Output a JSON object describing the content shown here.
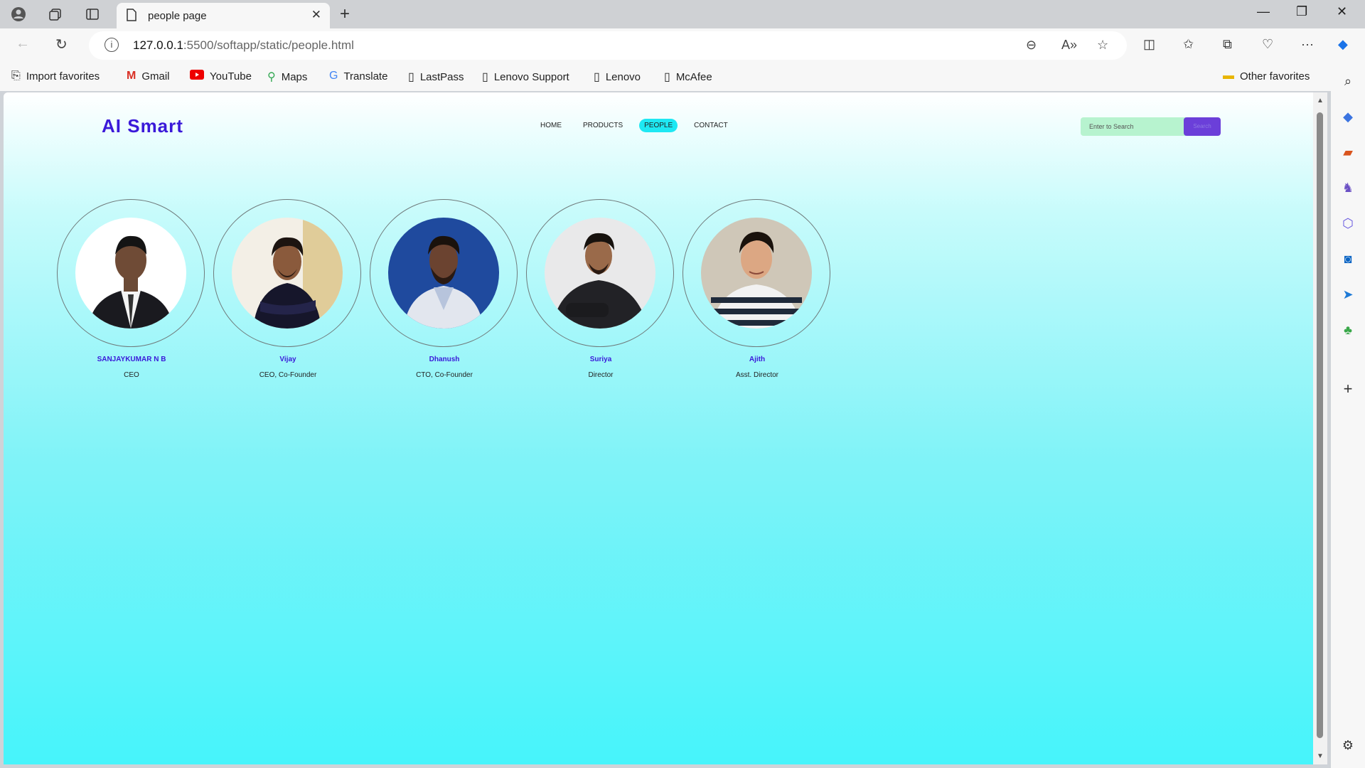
{
  "browser": {
    "tab_title": "people page",
    "url_host": "127.0.0.1",
    "url_rest": ":5500/softapp/static/people.html"
  },
  "bookmarks": [
    {
      "label": "Import favorites",
      "icon": "import-icon"
    },
    {
      "label": "Gmail",
      "icon": "gmail-icon"
    },
    {
      "label": "YouTube",
      "icon": "youtube-icon"
    },
    {
      "label": "Maps",
      "icon": "maps-icon"
    },
    {
      "label": "Translate",
      "icon": "translate-icon"
    },
    {
      "label": "LastPass",
      "icon": "page-icon"
    },
    {
      "label": "Lenovo Support",
      "icon": "page-icon"
    },
    {
      "label": "Lenovo",
      "icon": "page-icon"
    },
    {
      "label": "McAfee",
      "icon": "page-icon"
    }
  ],
  "other_favorites": "Other favorites",
  "site": {
    "brand": "AI Smart",
    "nav": [
      "HOME",
      "PRODUCTS",
      "PEOPLE",
      "CONTACT"
    ],
    "active_nav": "PEOPLE",
    "search_placeholder": "Enter to Search",
    "search_button": "Search"
  },
  "people": [
    {
      "name": "SANJAYKUMAR N B",
      "role": "CEO"
    },
    {
      "name": "Vijay",
      "role": "CEO, Co-Founder"
    },
    {
      "name": "Dhanush",
      "role": "CTO, Co-Founder"
    },
    {
      "name": "Suriya",
      "role": "Director"
    },
    {
      "name": "Ajith",
      "role": "Asst. Director"
    }
  ]
}
